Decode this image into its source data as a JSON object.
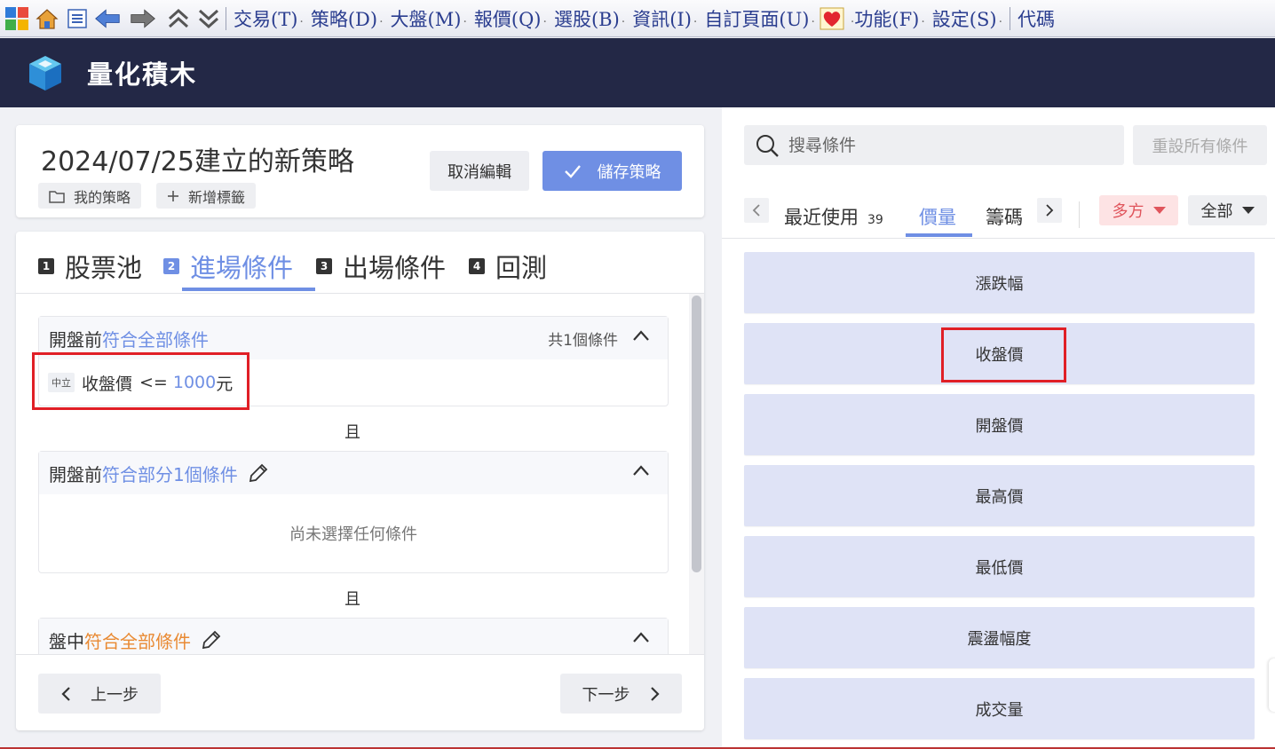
{
  "menubar": {
    "items": [
      "交易(T)",
      "策略(D)",
      "大盤(M)",
      "報價(Q)",
      "選股(B)",
      "資訊(I)",
      "自訂頁面(U)",
      "功能(F)",
      "設定(S)",
      "代碼"
    ]
  },
  "app": {
    "title": "量化積木"
  },
  "strategy": {
    "title": "2024/07/25建立的新策略",
    "folder_label": "我的策略",
    "add_tag_label": "新增標籤",
    "cancel_label": "取消編輯",
    "save_label": "儲存策略"
  },
  "steps": [
    {
      "num": "1",
      "label": "股票池"
    },
    {
      "num": "2",
      "label": "進場條件"
    },
    {
      "num": "3",
      "label": "出場條件"
    },
    {
      "num": "4",
      "label": "回測"
    }
  ],
  "groups": [
    {
      "prefix": "開盤前",
      "accent": "符合全部條件",
      "count": "共1個條件",
      "condition": {
        "badge": "中立",
        "name": "收盤價",
        "op": "<=",
        "value": "1000",
        "unit": "元"
      }
    },
    {
      "prefix": "開盤前",
      "accent": "符合部分1個條件",
      "empty": "尚未選擇任何條件"
    },
    {
      "prefix": "盤中",
      "accent": "符合全部條件"
    }
  ],
  "and_label": "且",
  "footer": {
    "prev_label": "上一步",
    "next_label": "下一步"
  },
  "right": {
    "search_placeholder": "搜尋條件",
    "reset_label": "重設所有條件",
    "tabs": [
      {
        "label": "最近使用",
        "count": "39"
      },
      {
        "label": "價量"
      },
      {
        "label": "籌碼"
      }
    ],
    "filter_direction": "多方",
    "filter_scope": "全部",
    "conditions": [
      "漲跌幅",
      "收盤價",
      "開盤價",
      "最高價",
      "最低價",
      "震盪幅度",
      "成交量"
    ]
  },
  "colors": {
    "accent": "#6f8fe4",
    "header_bg": "#232846",
    "highlight": "#e01f26",
    "condition_btn": "#dfe3f6",
    "orange": "#e98a33"
  }
}
